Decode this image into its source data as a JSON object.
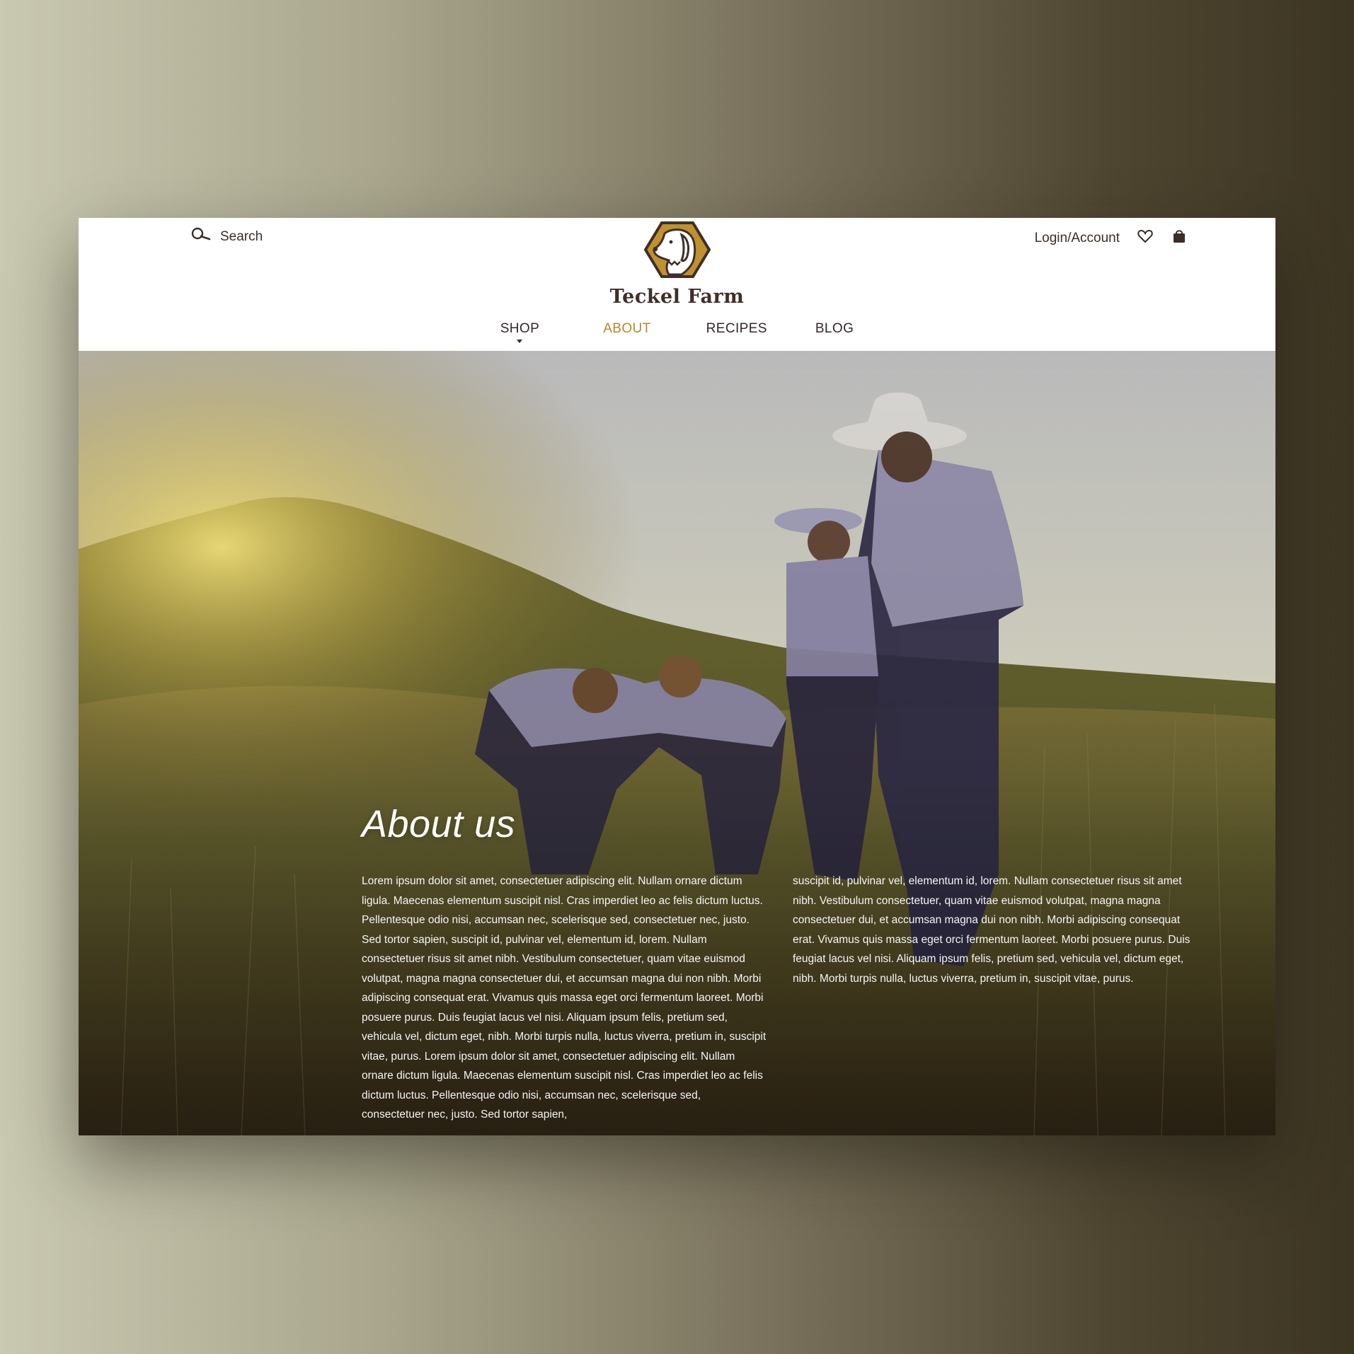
{
  "header": {
    "search_label": "Search",
    "brand_name": "Teckel Farm",
    "login_label": "Login/Account",
    "nav": [
      {
        "label": "SHOP",
        "has_dropdown": true,
        "active": false
      },
      {
        "label": "ABOUT",
        "active": true
      },
      {
        "label": "RECIPES",
        "active": false
      },
      {
        "label": "BLOG",
        "active": false
      }
    ],
    "icons": {
      "search": "search-icon",
      "logo": "dog-hexagon-logo",
      "wishlist": "heart-icon",
      "cart": "shopping-bag-icon"
    }
  },
  "hero": {
    "title": "About us",
    "column_1": "Lorem ipsum dolor sit amet, consectetuer adipiscing elit. Nullam ornare dictum ligula. Maecenas elementum suscipit nisl. Cras imperdiet leo ac felis dictum luctus. Pellentesque odio nisi, accumsan nec, scelerisque sed, consectetuer nec, justo. Sed tortor sapien, suscipit id, pulvinar vel, elementum id, lorem. Nullam consectetuer risus sit amet nibh. Vestibulum consectetuer, quam vitae euismod volutpat, magna magna consectetuer dui, et accumsan magna dui non nibh. Morbi adipiscing consequat erat. Vivamus quis massa eget orci fermentum laoreet. Morbi posuere purus. Duis feugiat lacus vel nisi. Aliquam ipsum felis, pretium sed, vehicula vel, dictum eget, nibh. Morbi turpis nulla, luctus viverra, pretium in, suscipit vitae, purus. Lorem ipsum dolor sit amet, consectetuer adipiscing elit. Nullam ornare dictum ligula. Maecenas elementum suscipit nisl. Cras imperdiet leo ac felis dictum luctus. Pellentesque odio nisi, accumsan nec, scelerisque sed, consectetuer nec, justo. Sed tortor sapien,",
    "column_2": "suscipit id, pulvinar vel, elementum id, lorem. Nullam consectetuer risus sit amet nibh. Vestibulum consectetuer, quam vitae euismod volutpat, magna magna consectetuer dui, et accumsan magna dui non nibh. Morbi adipiscing consequat erat. Vivamus quis massa eget orci fermentum laoreet. Morbi posuere purus. Duis feugiat lacus vel nisi. Aliquam ipsum felis, pretium sed, vehicula vel, dictum eget, nibh. Morbi turpis nulla, luctus viverra, pretium in, suscipit vitae, purus."
  },
  "colors": {
    "accent": "#b4882c",
    "text_dark": "#3a2f28",
    "logo_gold": "#c0912f",
    "logo_brown": "#3f2f27"
  }
}
